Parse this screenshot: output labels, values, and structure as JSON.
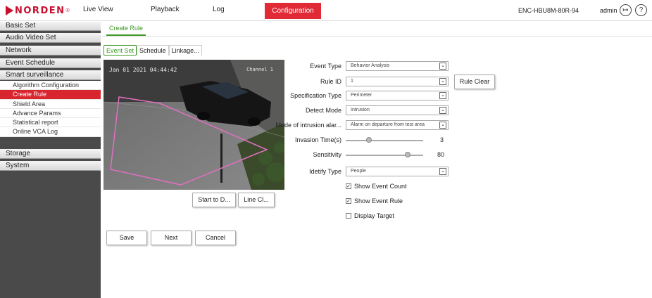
{
  "brand": {
    "name": "NORDEN",
    "reg": "®"
  },
  "nav": {
    "live_view": "Live View",
    "playback": "Playback",
    "log": "Log",
    "configuration": "Configuration"
  },
  "device": "ENC-HBU8M-80R-94",
  "user": "admin",
  "icons": {
    "logout": "logout-icon",
    "help": "help-icon"
  },
  "sidebar": {
    "basic_set": "Basic Set",
    "audio_video_set": "Audio Video Set",
    "network": "Network",
    "event_schedule": "Event Schedule",
    "smart_surveillance": "Smart surveillance",
    "sub": [
      "Algorithm Configuration",
      "Create Rule",
      "Shield Area",
      "Advance Params",
      "Statistical report",
      "Online VCA Log"
    ],
    "storage": "Storage",
    "system": "System"
  },
  "main_tab": "Create Rule",
  "subtabs": [
    "Event Set",
    "Schedule",
    "Linkage..."
  ],
  "video": {
    "timestamp": "Jan 01 2021 04:44:42",
    "channel": "Channel 1"
  },
  "video_buttons": {
    "start": "Start to D...",
    "line_clear": "Line Cl..."
  },
  "form": {
    "event_type": {
      "label": "Event Type",
      "value": "Behavior Analysis"
    },
    "rule_id": {
      "label": "Rule ID",
      "value": "1"
    },
    "rule_clear": "Rule Clear",
    "spec_type": {
      "label": "Specification Type",
      "value": "Perimeter"
    },
    "detect_mode": {
      "label": "Detect Mode",
      "value": "Intrusion"
    },
    "intrusion_alarm": {
      "label": "Mode of intrusion alar...",
      "value": "Alarm on departure from test area"
    },
    "invasion_time": {
      "label": "Invasion Time(s)",
      "value": "3",
      "fraction": 0.3
    },
    "sensitivity": {
      "label": "Sensitivity",
      "value": "80",
      "fraction": 0.8
    },
    "identify_type": {
      "label": "Idetify Type",
      "value": "People"
    },
    "show_event_count": {
      "label": "Show Event Count",
      "checked": true
    },
    "show_event_rule": {
      "label": "Show Event Rule",
      "checked": true
    },
    "display_target": {
      "label": "Display Target",
      "checked": false
    }
  },
  "actions": {
    "save": "Save",
    "next": "Next",
    "cancel": "Cancel"
  },
  "colors": {
    "brand_red": "#c8102e",
    "active_red": "#e02b36",
    "tab_green": "#3d9a23",
    "sidebar_dark": "#4a4a4a",
    "rule_line": "#e070c0"
  }
}
